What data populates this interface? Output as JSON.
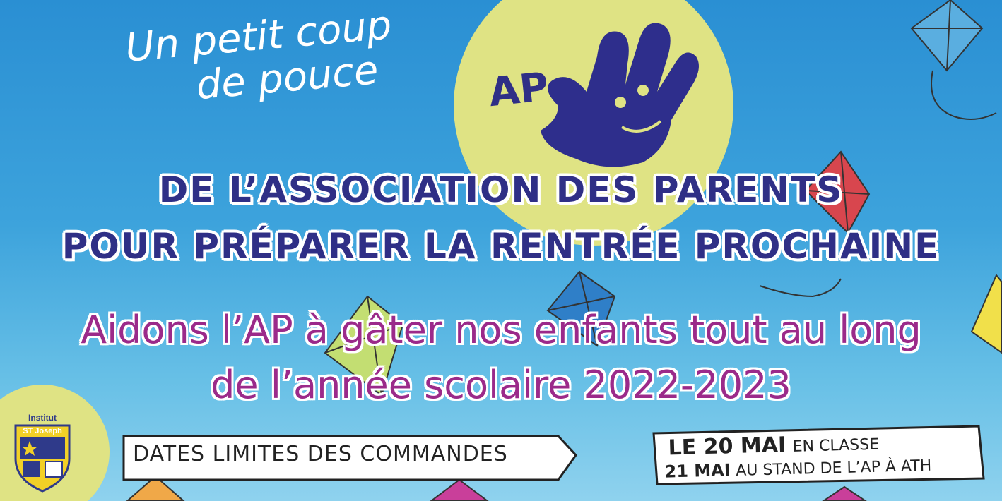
{
  "tagline": {
    "line1": "Un petit coup",
    "line2": "de pouce"
  },
  "logo": {
    "text": "AP"
  },
  "headline": {
    "line1": "DE L’ASSOCIATION DES PARENTS",
    "line2": "POUR PRÉPARER LA RENTRÉE PROCHAINE"
  },
  "appeal": {
    "line1": "Aidons l’AP à gâter nos enfants tout au long",
    "line2": "de l’année scolaire 2022-2023"
  },
  "deadline_sign": {
    "label": "DATES LIMITES DES COMMANDES"
  },
  "dates": {
    "date1": "LE 20 MAI",
    "place1": "EN CLASSE",
    "date2": "21 MAI",
    "place2": "AU STAND DE L’AP À ATH"
  },
  "school": {
    "line1": "Institut",
    "line2": "ST Joseph"
  },
  "colors": {
    "navy": "#2f2f86",
    "magenta": "#9b2a8a",
    "sky": "#2a8fd3",
    "sun": "#dfe384"
  },
  "icons": [
    "hand-icon",
    "kite-icon",
    "shield-icon",
    "arrow-sign-icon"
  ]
}
